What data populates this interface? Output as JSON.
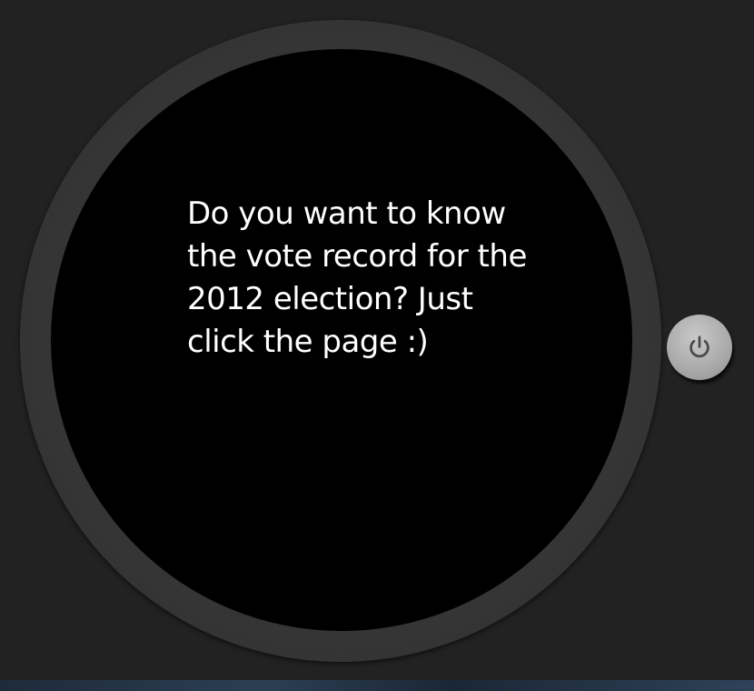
{
  "watch": {
    "message": "Do you want to know\nthe vote record for the\n2012 election? Just\nclick the page :)",
    "colors": {
      "background": "#222222",
      "bezel": "#353535",
      "face": "#000000",
      "text": "#ffffff",
      "button": "#b0b0b0",
      "button_icon": "#4a4a4a"
    }
  },
  "side_button": {
    "icon": "power-icon"
  }
}
